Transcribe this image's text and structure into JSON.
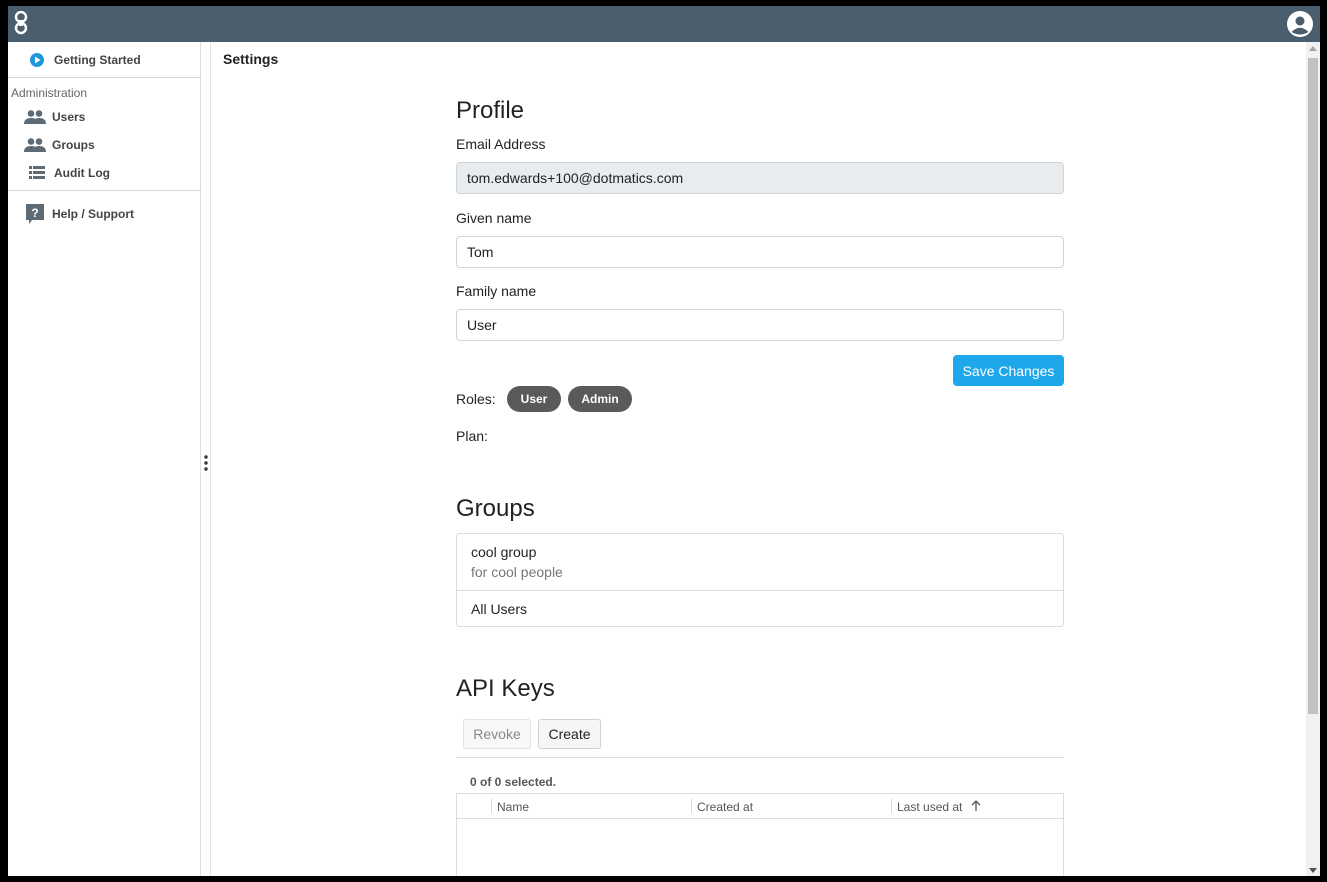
{
  "sidebar": {
    "getting_started": "Getting Started",
    "admin_heading": "Administration",
    "users": "Users",
    "groups": "Groups",
    "audit_log": "Audit Log",
    "help": "Help / Support"
  },
  "breadcrumb": "Settings",
  "profile": {
    "title": "Profile",
    "email_label": "Email Address",
    "email_value": "tom.edwards+100@dotmatics.com",
    "given_label": "Given name",
    "given_value": "Tom",
    "family_label": "Family name",
    "family_value": "User",
    "save_label": "Save Changes",
    "roles_label": "Roles:",
    "roles": [
      "User",
      "Admin"
    ],
    "plan_label": "Plan:"
  },
  "groups": {
    "title": "Groups",
    "items": [
      {
        "name": "cool group",
        "description": "for cool people"
      },
      {
        "name": "All Users"
      }
    ]
  },
  "api_keys": {
    "title": "API Keys",
    "revoke_label": "Revoke",
    "create_label": "Create",
    "selection": "0 of 0 selected.",
    "columns": [
      "Name",
      "Created at",
      "Last used at"
    ]
  },
  "colors": {
    "topbar": "#4b5e6e",
    "primary": "#1ea7ea",
    "pill": "#5a5a5a"
  }
}
